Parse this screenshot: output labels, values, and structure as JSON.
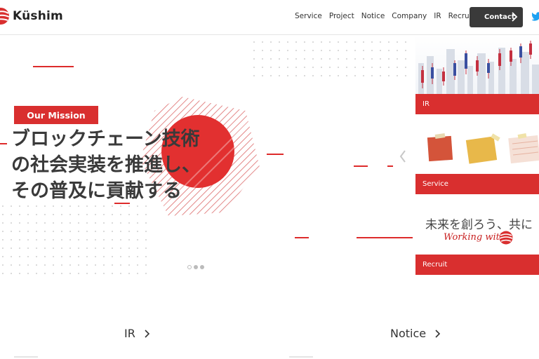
{
  "header": {
    "brand": "Küshim",
    "nav": [
      "Service",
      "Project",
      "Notice",
      "Company",
      "IR",
      "Recruit"
    ],
    "contact_label": "Contact"
  },
  "hero": {
    "badge": "Our Mission",
    "title_lines": [
      "ブロックチェーン技術",
      "の社会実装を推進し、",
      "その普及に貢献する"
    ],
    "pager_active_index": 0,
    "pager_count": 3
  },
  "cards": [
    {
      "label": "IR"
    },
    {
      "label": "Service"
    },
    {
      "label": "Recruit",
      "tagline": "未来を創ろう、共に",
      "working": "Working with"
    }
  ],
  "sections": {
    "ir": "IR",
    "notice": "Notice"
  },
  "colors": {
    "accent": "#d92f2f",
    "contact_bg": "#3a3a3a",
    "twitter": "#1da1f2"
  },
  "icons": [
    "kushim-logo-icon",
    "chevron-right-icon",
    "twitter-icon",
    "slider-prev-arrow-icon"
  ]
}
